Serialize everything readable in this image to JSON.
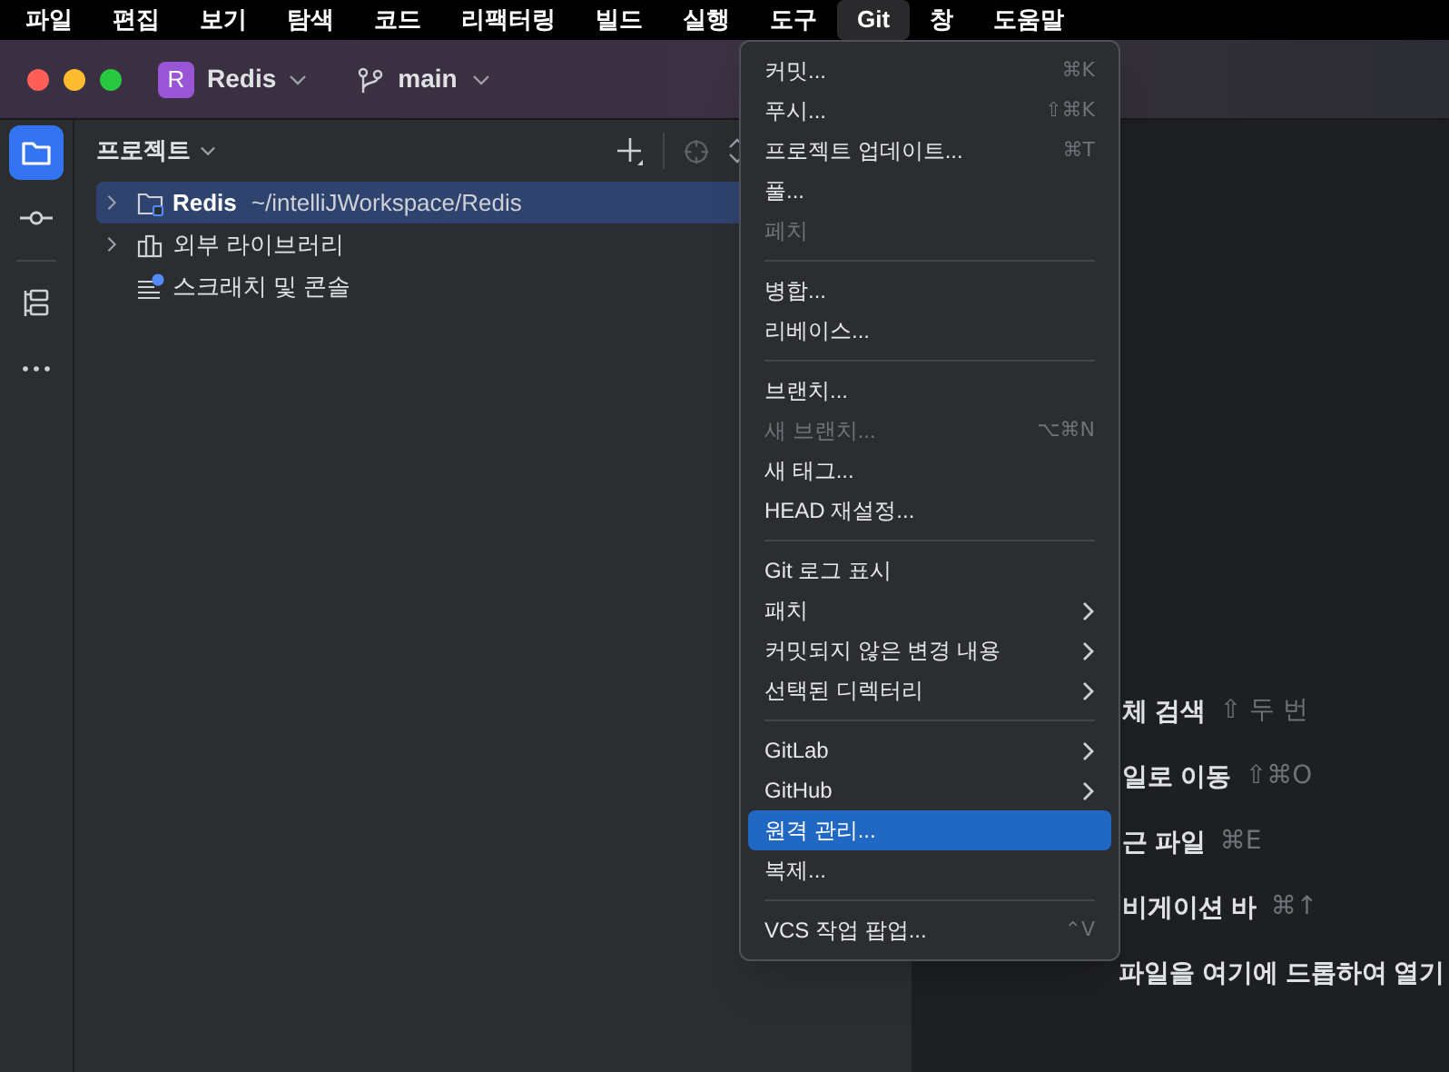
{
  "menu_bar": [
    {
      "label": "파일",
      "selected": false
    },
    {
      "label": "편집",
      "selected": false
    },
    {
      "label": "보기",
      "selected": false
    },
    {
      "label": "탐색",
      "selected": false
    },
    {
      "label": "코드",
      "selected": false
    },
    {
      "label": "리팩터링",
      "selected": false
    },
    {
      "label": "빌드",
      "selected": false
    },
    {
      "label": "실행",
      "selected": false
    },
    {
      "label": "도구",
      "selected": false
    },
    {
      "label": "Git",
      "selected": true
    },
    {
      "label": "창",
      "selected": false
    },
    {
      "label": "도움말",
      "selected": false
    }
  ],
  "title_bar": {
    "project_badge": "R",
    "project": "Redis",
    "branch": "main"
  },
  "tool_strip": [
    {
      "kind": "folder",
      "selected": true
    },
    {
      "kind": "commit",
      "selected": false
    },
    {
      "kind": "structure",
      "selected": false
    },
    {
      "kind": "more",
      "selected": false
    }
  ],
  "project_panel": {
    "title": "프로젝트",
    "tree": [
      {
        "name": "Redis",
        "path": "~/intelliJWorkspace/Redis",
        "kind": "module",
        "expanded": false,
        "selected": true
      },
      {
        "name": "외부 라이브러리",
        "kind": "libraries",
        "expanded": false,
        "selected": false
      },
      {
        "name": "스크래치 및 콘솔",
        "kind": "scratches",
        "selected": false
      }
    ]
  },
  "git_menu": {
    "sections": [
      [
        {
          "label": "커밋...",
          "shortcut": "⌘K",
          "disabled": false,
          "submenu": false,
          "selected": false
        },
        {
          "label": "푸시...",
          "shortcut": "⇧⌘K",
          "disabled": false,
          "submenu": false,
          "selected": false
        },
        {
          "label": "프로젝트 업데이트...",
          "shortcut": "⌘T",
          "disabled": false,
          "submenu": false,
          "selected": false
        },
        {
          "label": "풀...",
          "disabled": false,
          "submenu": false,
          "selected": false
        },
        {
          "label": "페치",
          "disabled": true,
          "submenu": false,
          "selected": false
        }
      ],
      [
        {
          "label": "병합...",
          "disabled": false,
          "submenu": false,
          "selected": false
        },
        {
          "label": "리베이스...",
          "disabled": false,
          "submenu": false,
          "selected": false
        }
      ],
      [
        {
          "label": "브랜치...",
          "disabled": false,
          "submenu": false,
          "selected": false
        },
        {
          "label": "새 브랜치...",
          "shortcut": "⌥⌘N",
          "disabled": true,
          "submenu": false,
          "selected": false
        },
        {
          "label": "새 태그...",
          "disabled": false,
          "submenu": false,
          "selected": false
        },
        {
          "label": "HEAD 재설정...",
          "disabled": false,
          "submenu": false,
          "selected": false
        }
      ],
      [
        {
          "label": "Git 로그 표시",
          "disabled": false,
          "submenu": false,
          "selected": false
        },
        {
          "label": "패치",
          "disabled": false,
          "submenu": true,
          "selected": false
        },
        {
          "label": "커밋되지 않은 변경 내용",
          "disabled": false,
          "submenu": true,
          "selected": false
        },
        {
          "label": "선택된 디렉터리",
          "disabled": false,
          "submenu": true,
          "selected": false
        }
      ],
      [
        {
          "label": "GitLab",
          "disabled": false,
          "submenu": true,
          "selected": false
        },
        {
          "label": "GitHub",
          "disabled": false,
          "submenu": true,
          "selected": false
        },
        {
          "label": "원격 관리...",
          "disabled": false,
          "submenu": false,
          "selected": true
        },
        {
          "label": "복제...",
          "disabled": false,
          "submenu": false,
          "selected": false
        }
      ],
      [
        {
          "label": "VCS 작업 팝업...",
          "shortcut": "⌃V",
          "disabled": false,
          "submenu": false,
          "selected": false
        }
      ]
    ]
  },
  "editor_hints": [
    {
      "label": "체 검색",
      "shortcut": "⇧ 두 번"
    },
    {
      "label": "일로 이동",
      "shortcut": "⇧⌘O"
    },
    {
      "label": "근 파일",
      "shortcut": "⌘E"
    },
    {
      "label": "비게이션 바",
      "shortcut": "⌘↑"
    },
    {
      "label": "파일을 여기에 드롭하여 열기"
    }
  ]
}
